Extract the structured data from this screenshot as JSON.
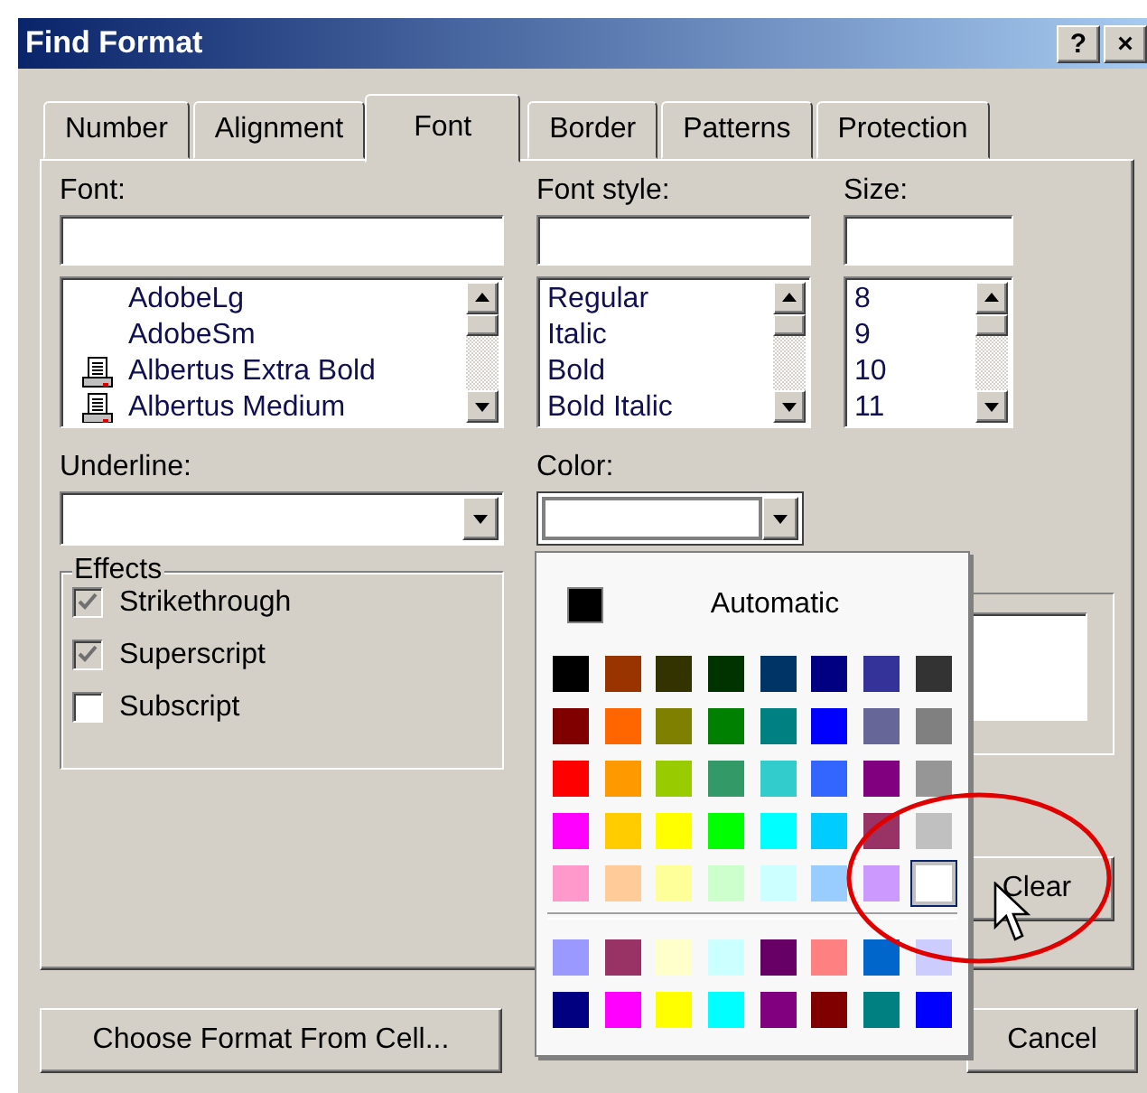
{
  "window": {
    "title": "Find Format",
    "help_button": "?",
    "close_button": "×"
  },
  "tabs": [
    {
      "label": "Number",
      "selected": false
    },
    {
      "label": "Alignment",
      "selected": false
    },
    {
      "label": "Font",
      "selected": true
    },
    {
      "label": "Border",
      "selected": false
    },
    {
      "label": "Patterns",
      "selected": false
    },
    {
      "label": "Protection",
      "selected": false
    }
  ],
  "font": {
    "label": "Font:",
    "items": [
      {
        "text": "AdobeLg",
        "kind": "plain"
      },
      {
        "text": "AdobeSm",
        "kind": "plain"
      },
      {
        "text": "Albertus Extra Bold",
        "kind": "printer"
      },
      {
        "text": "Albertus Medium",
        "kind": "printer"
      }
    ]
  },
  "font_style": {
    "label": "Font style:",
    "items": [
      "Regular",
      "Italic",
      "Bold",
      "Bold Italic"
    ]
  },
  "size": {
    "label": "Size:",
    "items": [
      "8",
      "9",
      "10",
      "11"
    ]
  },
  "underline": {
    "label": "Underline:"
  },
  "color": {
    "label": "Color:"
  },
  "effects": {
    "title": "Effects",
    "options": [
      {
        "label": "Strikethrough",
        "checked": true
      },
      {
        "label": "Superscript",
        "checked": true
      },
      {
        "label": "Subscript",
        "checked": false
      }
    ]
  },
  "color_palette": {
    "automatic": {
      "label": "Automatic",
      "color": "#000000"
    },
    "standard_rows": [
      [
        {
          "color": "#000000",
          "selected": false
        },
        {
          "color": "#993300",
          "selected": false
        },
        {
          "color": "#333300",
          "selected": false
        },
        {
          "color": "#003300",
          "selected": false
        },
        {
          "color": "#003366",
          "selected": false
        },
        {
          "color": "#000080",
          "selected": false
        },
        {
          "color": "#333399",
          "selected": false
        },
        {
          "color": "#333333",
          "selected": false
        }
      ],
      [
        {
          "color": "#800000",
          "selected": false
        },
        {
          "color": "#ff6600",
          "selected": false
        },
        {
          "color": "#808000",
          "selected": false
        },
        {
          "color": "#008000",
          "selected": false
        },
        {
          "color": "#008080",
          "selected": false
        },
        {
          "color": "#0000ff",
          "selected": false
        },
        {
          "color": "#666699",
          "selected": false
        },
        {
          "color": "#808080",
          "selected": false
        }
      ],
      [
        {
          "color": "#ff0000",
          "selected": false
        },
        {
          "color": "#ff9900",
          "selected": false
        },
        {
          "color": "#99cc00",
          "selected": false
        },
        {
          "color": "#339966",
          "selected": false
        },
        {
          "color": "#33cccc",
          "selected": false
        },
        {
          "color": "#3366ff",
          "selected": false
        },
        {
          "color": "#800080",
          "selected": false
        },
        {
          "color": "#969696",
          "selected": false
        }
      ],
      [
        {
          "color": "#ff00ff",
          "selected": false
        },
        {
          "color": "#ffcc00",
          "selected": false
        },
        {
          "color": "#ffff00",
          "selected": false
        },
        {
          "color": "#00ff00",
          "selected": false
        },
        {
          "color": "#00ffff",
          "selected": false
        },
        {
          "color": "#00ccff",
          "selected": false
        },
        {
          "color": "#993366",
          "selected": false
        },
        {
          "color": "#c0c0c0",
          "selected": false
        }
      ],
      [
        {
          "color": "#ff99cc",
          "selected": false
        },
        {
          "color": "#ffcc99",
          "selected": false
        },
        {
          "color": "#ffff99",
          "selected": false
        },
        {
          "color": "#ccffcc",
          "selected": false
        },
        {
          "color": "#ccffff",
          "selected": false
        },
        {
          "color": "#99ccff",
          "selected": false
        },
        {
          "color": "#cc99ff",
          "selected": false
        },
        {
          "color": "#ffffff",
          "selected": true
        }
      ]
    ],
    "chart_rows": [
      [
        {
          "color": "#9999ff",
          "selected": false
        },
        {
          "color": "#993366",
          "selected": false
        },
        {
          "color": "#ffffcc",
          "selected": false
        },
        {
          "color": "#ccffff",
          "selected": false
        },
        {
          "color": "#660066",
          "selected": false
        },
        {
          "color": "#ff8080",
          "selected": false
        },
        {
          "color": "#0066cc",
          "selected": false
        },
        {
          "color": "#ccccff",
          "selected": false
        }
      ],
      [
        {
          "color": "#000080",
          "selected": false
        },
        {
          "color": "#ff00ff",
          "selected": false
        },
        {
          "color": "#ffff00",
          "selected": false
        },
        {
          "color": "#00ffff",
          "selected": false
        },
        {
          "color": "#800080",
          "selected": false
        },
        {
          "color": "#800000",
          "selected": false
        },
        {
          "color": "#008080",
          "selected": false
        },
        {
          "color": "#0000ff",
          "selected": false
        }
      ]
    ]
  },
  "buttons": {
    "clear": "Clear",
    "choose_format": "Choose Format From Cell...",
    "cancel": "Cancel"
  }
}
